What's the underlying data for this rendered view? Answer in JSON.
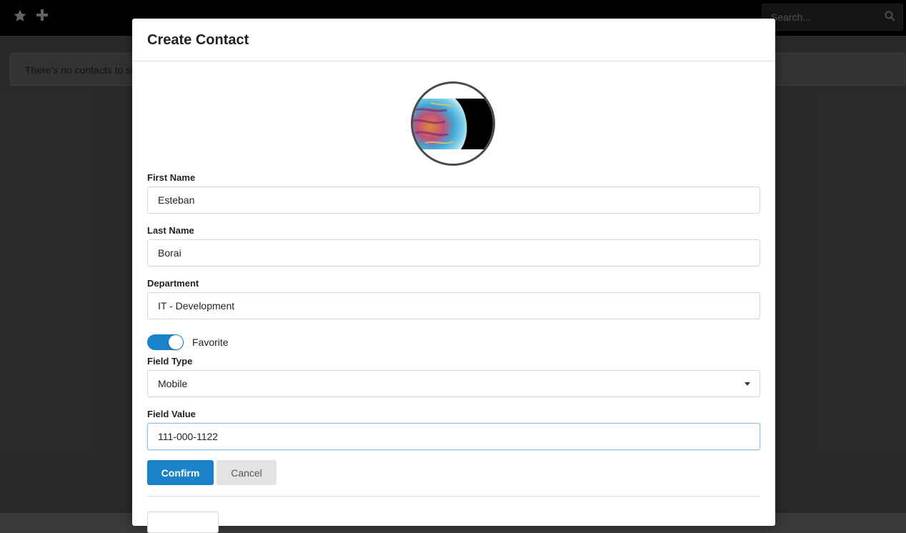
{
  "app": {
    "toolbar": {
      "favorites_icon": "star-icon",
      "add_icon": "plus-icon"
    },
    "search": {
      "placeholder": "Search...",
      "icon": "search-icon"
    },
    "notice": "There's no contacts to show"
  },
  "modal": {
    "title": "Create Contact",
    "avatar_icon": "avatar-image",
    "first_name": {
      "label": "First Name",
      "value": "Esteban"
    },
    "last_name": {
      "label": "Last Name",
      "value": "Borai"
    },
    "department": {
      "label": "Department",
      "value": "IT - Development"
    },
    "favorite": {
      "label": "Favorite",
      "checked": true
    },
    "field_type": {
      "label": "Field Type",
      "value": "Mobile"
    },
    "field_value": {
      "label": "Field Value",
      "value": "111-000-1122"
    },
    "confirm_label": "Confirm",
    "cancel_label": "Cancel"
  },
  "colors": {
    "primary": "#1a82c8",
    "overlay": "#3a3a3a",
    "topbar": "#000000"
  }
}
